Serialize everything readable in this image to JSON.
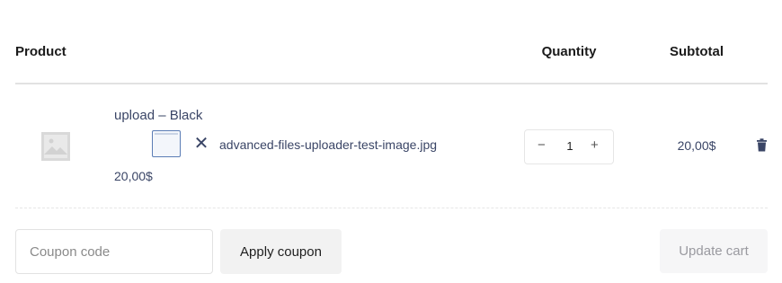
{
  "table": {
    "headers": {
      "product": "Product",
      "quantity": "Quantity",
      "subtotal": "Subtotal"
    }
  },
  "cart_item": {
    "name": "upload – Black",
    "file_name": "advanced-files-uploader-test-image.jpg",
    "remove_file_icon": "close-icon",
    "price": "20,00$",
    "quantity": "1",
    "qty_minus": "−",
    "qty_plus": "+",
    "subtotal": "20,00$",
    "remove_icon": "trash-icon"
  },
  "actions": {
    "coupon_placeholder": "Coupon code",
    "coupon_value": "",
    "apply_coupon": "Apply coupon",
    "update_cart": "Update cart"
  }
}
